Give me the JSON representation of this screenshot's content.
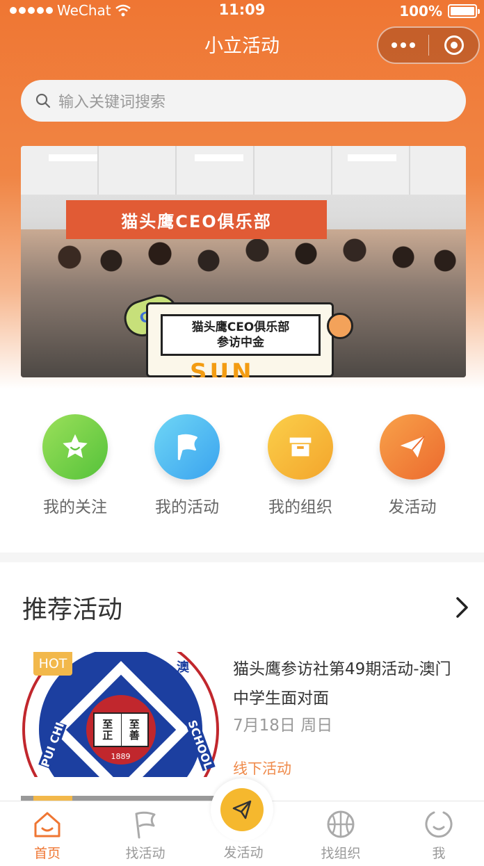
{
  "status_bar": {
    "carrier": "WeChat",
    "time": "11:09",
    "battery": "100%"
  },
  "nav": {
    "title": "小立活动"
  },
  "search": {
    "placeholder": "输入关键词搜索"
  },
  "banner": {
    "flag_text": "猫头鹰CEO俱乐部",
    "sign_line1": "猫头鹰CEO俱乐部",
    "sign_line2": "参访中金",
    "sign_big": "SUN",
    "bubble_text": "GG"
  },
  "quick_entries": [
    {
      "label": "我的关注",
      "icon": "star-icon",
      "color": "#7fd34a"
    },
    {
      "label": "我的活动",
      "icon": "flag-icon",
      "color": "#4fb8f0"
    },
    {
      "label": "我的组织",
      "icon": "box-icon",
      "color": "#f6b63a"
    },
    {
      "label": "发活动",
      "icon": "paper-plane-icon",
      "color": "#f07a3a"
    }
  ],
  "recommended": {
    "title": "推荐活动",
    "items": [
      {
        "badge": "HOT",
        "title": "猫头鹰参访社第49期活动-澳门中学生面对面",
        "date": "7月18日 周日",
        "tag": "线下活动",
        "emblem_year": "1889",
        "emblem_text_left": "PUI CHI",
        "emblem_text_right": "SCHOOL",
        "emblem_book": [
          "至",
          "正",
          "至",
          "善"
        ],
        "emblem_top": "澳"
      }
    ]
  },
  "tabbar": {
    "tabs": [
      {
        "label": "首页",
        "icon": "home-icon",
        "active": true
      },
      {
        "label": "找活动",
        "icon": "flag-icon",
        "active": false
      },
      {
        "label": "发活动",
        "icon": "paper-plane-icon",
        "active": false
      },
      {
        "label": "找组织",
        "icon": "basketball-icon",
        "active": false
      },
      {
        "label": "我",
        "icon": "smile-icon",
        "active": false
      }
    ]
  },
  "colors": {
    "brand_orange": "#ef7633",
    "tag_orange": "#ef8a4a",
    "hot_yellow": "#f2b84b"
  }
}
